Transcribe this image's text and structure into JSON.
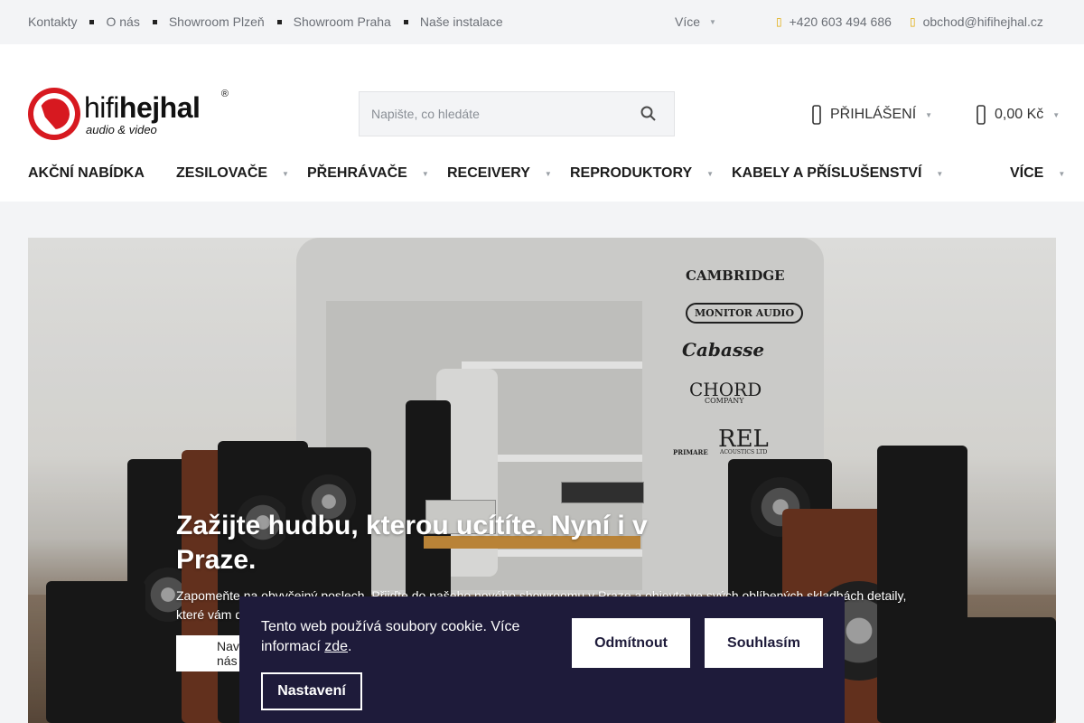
{
  "topbar": {
    "links": [
      "Kontakty",
      "O nás",
      "Showroom Plzeň",
      "Showroom Praha",
      "Naše instalace"
    ],
    "more_label": "Více",
    "phone": "+420 603 494 686",
    "email": "obchod@hifihejhal.cz"
  },
  "header": {
    "logo": {
      "word_light": "hifi",
      "word_bold": "hejhal",
      "tagline": "audio & video",
      "reg": "®"
    },
    "search_placeholder": "Napište, co hledáte",
    "login_label": "PŘIHLÁŠENÍ",
    "cart_total": "0,00 Kč"
  },
  "mainnav": {
    "items": [
      "AKČNÍ NABÍDKA",
      "ZESILOVAČE",
      "PŘEHRÁVAČE",
      "RECEIVERY",
      "REPRODUKTORY",
      "KABELY A PŘÍSLUŠENSTVÍ"
    ],
    "more_label": "VÍCE"
  },
  "hero": {
    "title": "Zažijte hudbu, kterou ucítíte. Nyní i v Praze.",
    "text": "Zapomeňte na obvyčejný poslech. Přijďte do našeho nového showroomu v Praze a objevte ve svých oblíbených skladbách detaily, které vám dosud unikaly.",
    "button_label": "Navštivte nás",
    "wall_brands": [
      "CAMBRIDGE",
      "MONITOR AUDIO",
      "Cabasse",
      "CHORD",
      "COMPANY",
      "PRIMARE",
      "REL",
      "ACOUSTICS LTD"
    ]
  },
  "cookie": {
    "text_prefix": "Tento web používá soubory cookie. Více informací ",
    "link_text": "zde",
    "text_suffix": ".",
    "decline_label": "Odmítnout",
    "accept_label": "Souhlasím",
    "settings_label": "Nastavení"
  },
  "colors": {
    "brand_red": "#d71920",
    "cookie_bg": "#1e1b3a",
    "accent_yellow": "#e0a800"
  }
}
